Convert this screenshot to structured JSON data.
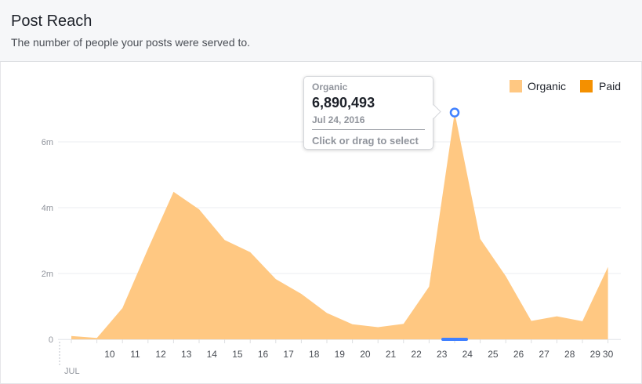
{
  "header": {
    "title": "Post Reach",
    "subtitle": "The number of people your posts were served to."
  },
  "tooltip": {
    "series": "Organic",
    "value": "6,890,493",
    "date": "Jul 24, 2016",
    "hint": "Click or drag to select"
  },
  "colors": {
    "organic": "#ffc882",
    "paid": "#f49000",
    "highlight": "#4080ff",
    "grid": "#ebedf0",
    "tick_label": "#90949c"
  },
  "chart_data": {
    "type": "area",
    "x": [
      "9",
      "10",
      "11",
      "12",
      "13",
      "14",
      "15",
      "16",
      "17",
      "18",
      "19",
      "20",
      "21",
      "22",
      "23",
      "24",
      "25",
      "26",
      "27",
      "28",
      "29",
      "30"
    ],
    "x_tick_labels": [
      "10",
      "11",
      "12",
      "13",
      "14",
      "15",
      "16",
      "17",
      "18",
      "19",
      "20",
      "21",
      "22",
      "23",
      "24",
      "25",
      "26",
      "27",
      "28",
      "29",
      "30"
    ],
    "x_month_label": "JUL",
    "series": [
      {
        "name": "Organic",
        "values": [
          100000,
          40000,
          950000,
          2750000,
          4480000,
          3950000,
          3020000,
          2650000,
          1830000,
          1380000,
          800000,
          460000,
          370000,
          470000,
          1600000,
          6890493,
          3050000,
          1920000,
          560000,
          700000,
          550000,
          2200000
        ]
      },
      {
        "name": "Paid",
        "values": [
          0,
          0,
          0,
          0,
          0,
          0,
          0,
          0,
          0,
          0,
          0,
          0,
          0,
          0,
          0,
          0,
          0,
          0,
          0,
          0,
          0,
          0
        ]
      }
    ],
    "y_ticks": [
      0,
      2000000,
      4000000,
      6000000
    ],
    "y_tick_labels": [
      "0",
      "2m",
      "4m",
      "6m"
    ],
    "ylim": [
      0,
      7000000
    ],
    "highlighted_index": 15,
    "grid": true,
    "legend": "top-right"
  }
}
